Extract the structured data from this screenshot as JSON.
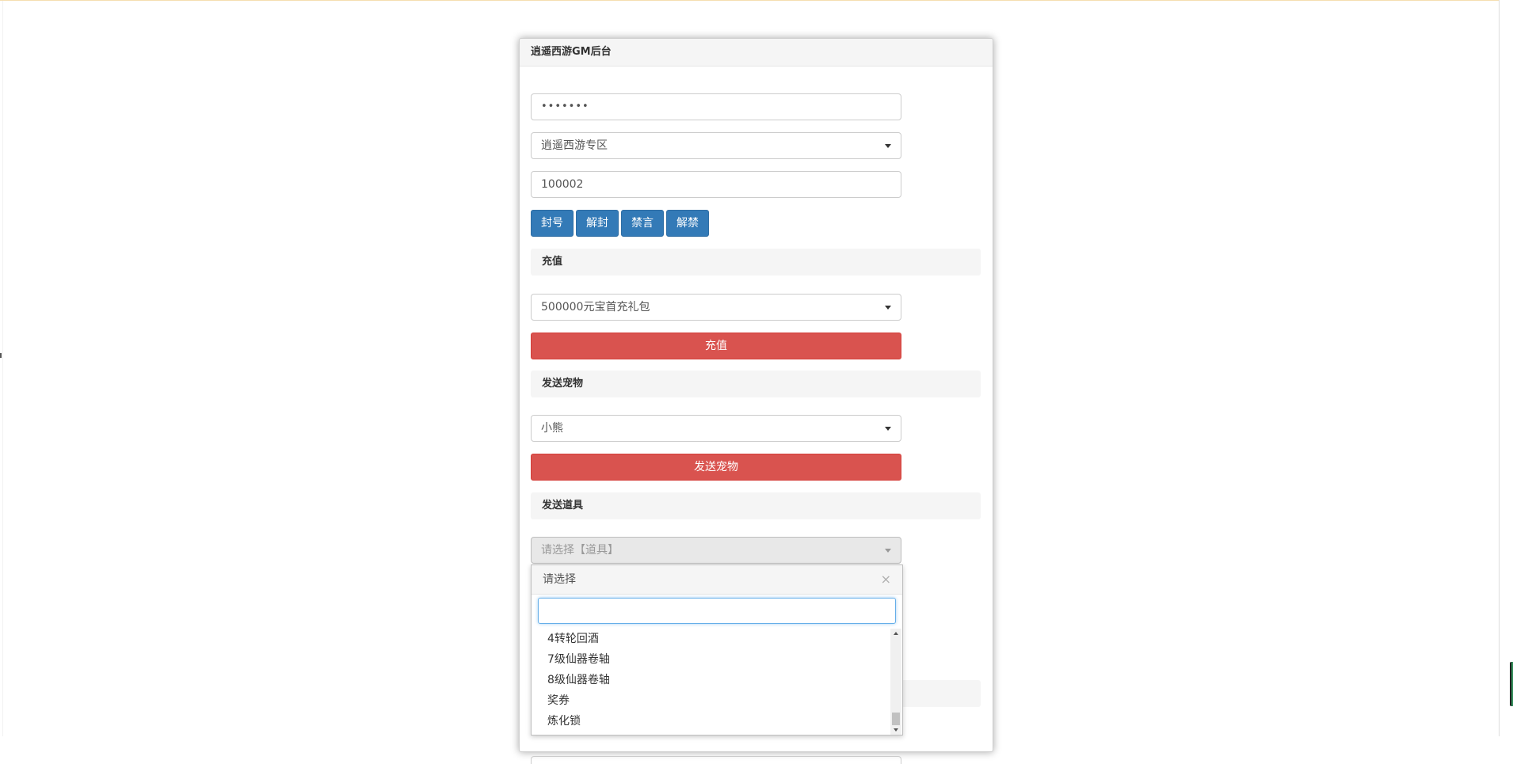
{
  "panel": {
    "title": "逍遥西游GM后台"
  },
  "login": {
    "password_value": "•••••••",
    "server_selected": "逍遥西游专区",
    "role_id_value": "100002"
  },
  "account_buttons": {
    "ban": "封号",
    "unban": "解封",
    "mute": "禁言",
    "unmute": "解禁"
  },
  "recharge": {
    "section_title": "充值",
    "package_selected": "500000元宝首充礼包",
    "submit_label": "充值"
  },
  "pet": {
    "section_title": "发送宠物",
    "pet_selected": "小熊",
    "submit_label": "发送宠物"
  },
  "item": {
    "section_title": "发送道具",
    "item_placeholder": "请选择【道具】"
  },
  "dropdown": {
    "header": "请选择",
    "close_glyph": "×",
    "search_value": "",
    "options": [
      "4转轮回酒",
      "7级仙器卷轴",
      "8级仙器卷轴",
      "奖券",
      "炼化锁"
    ]
  },
  "icons": {
    "select_caret": "caret-down-icon",
    "close": "close-icon"
  },
  "colors": {
    "primary_button": "#337ab7",
    "danger_button": "#d9534f",
    "section_bg": "#f5f5f5",
    "focus_border": "#66afe9"
  }
}
